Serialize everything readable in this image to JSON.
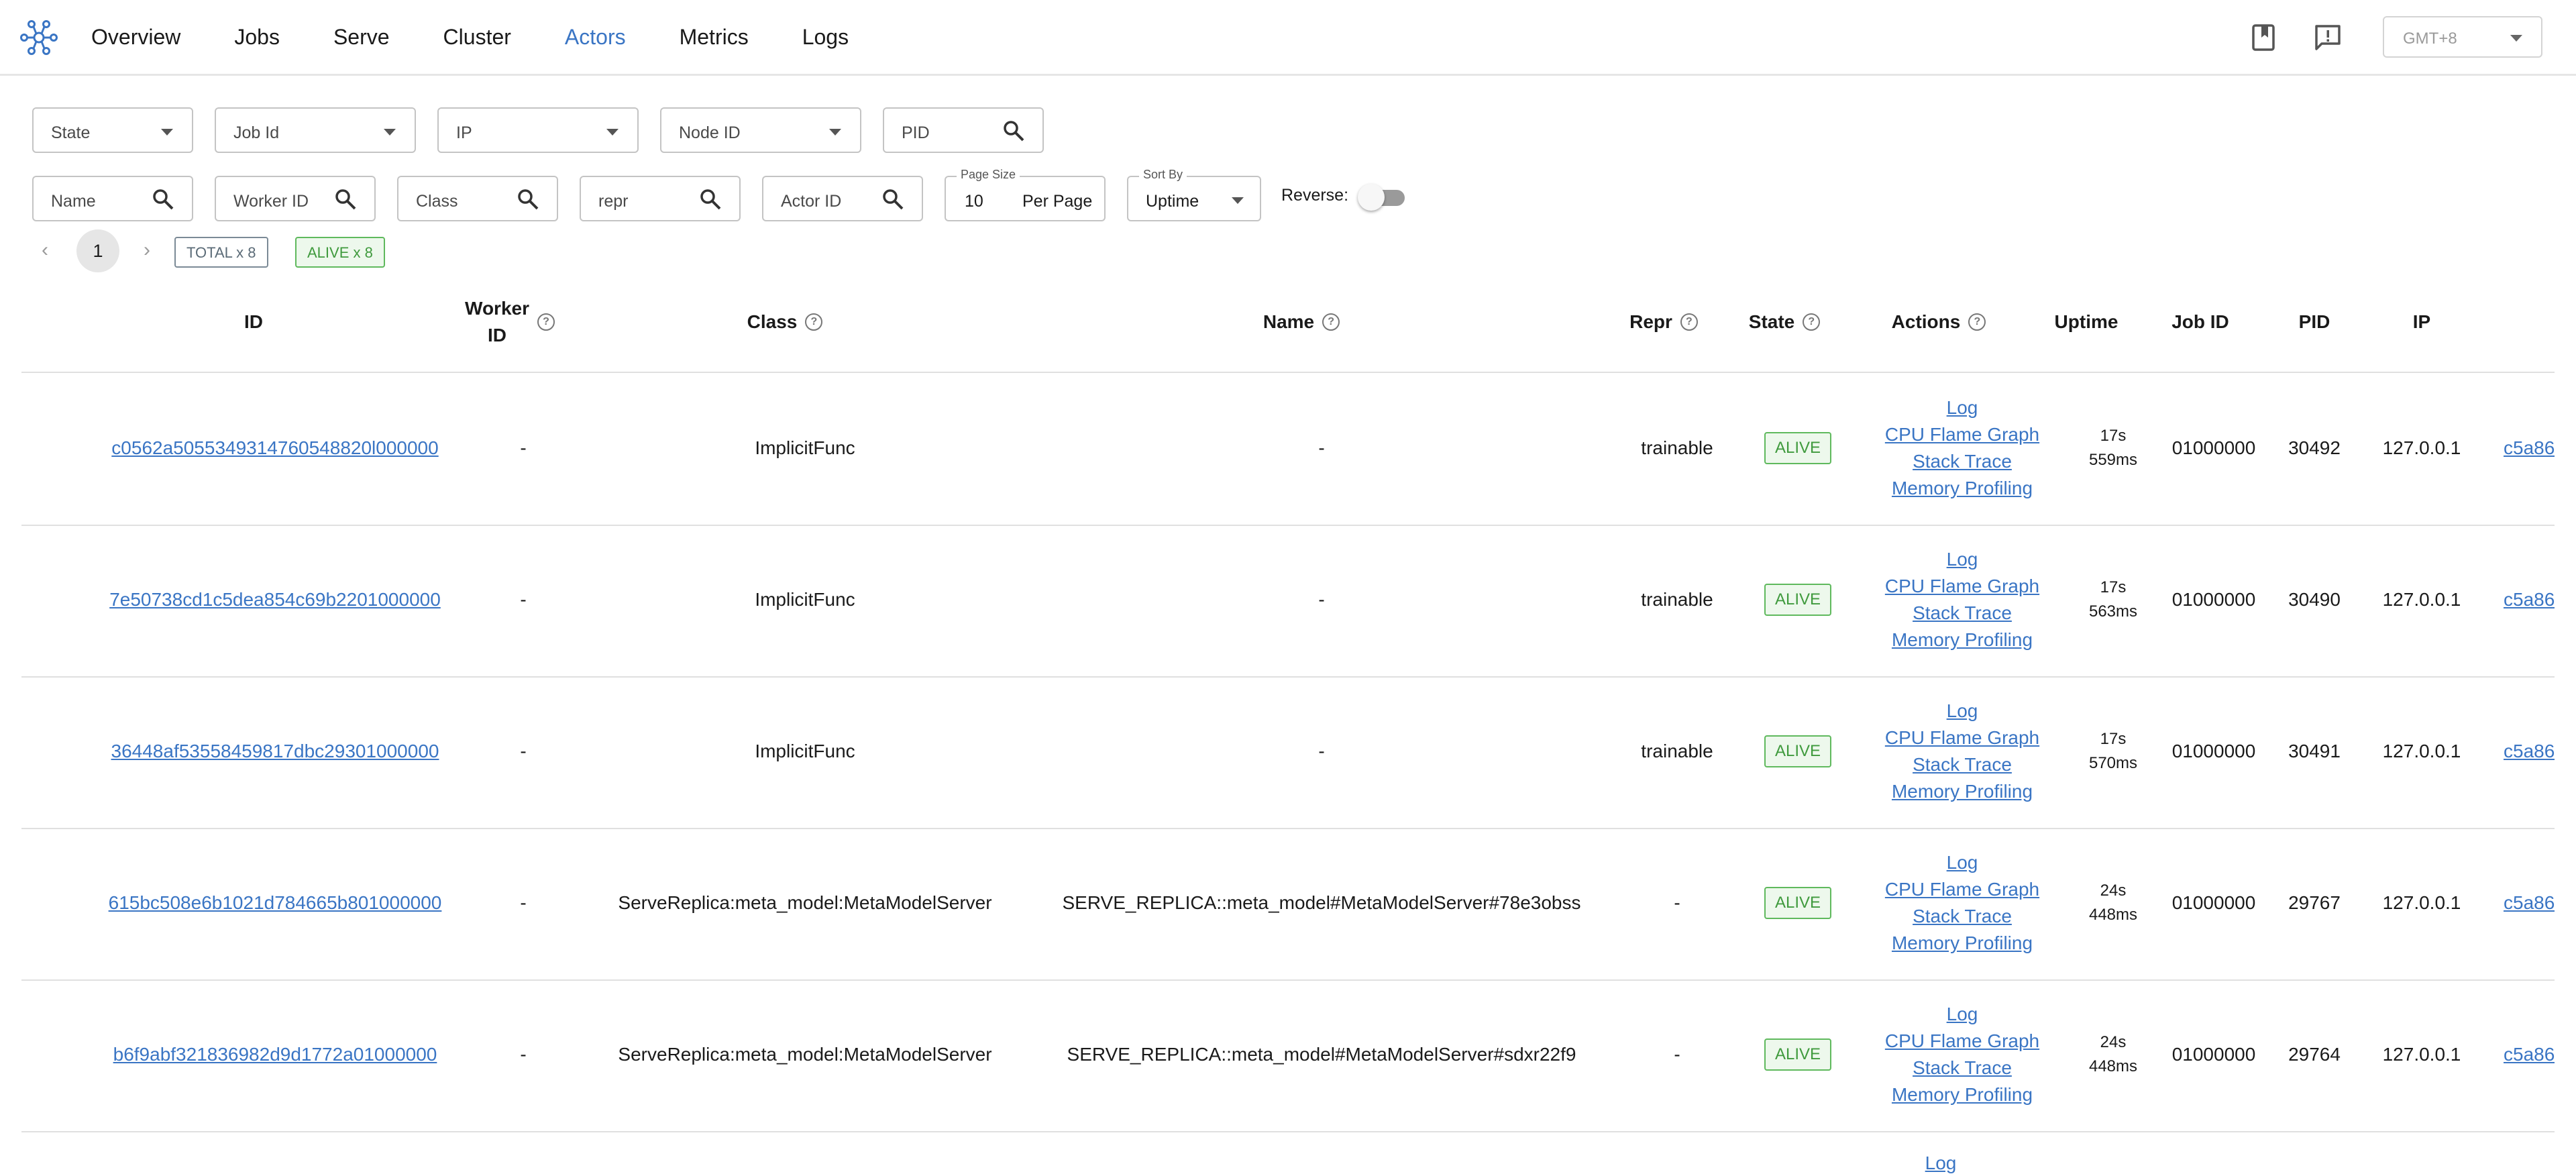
{
  "nav": {
    "links": [
      "Overview",
      "Jobs",
      "Serve",
      "Cluster",
      "Actors",
      "Metrics",
      "Logs"
    ],
    "active": "Actors",
    "timezone": "GMT+8",
    "accent_color": "#3a75c4"
  },
  "filters": {
    "state": "State",
    "job_id": "Job Id",
    "ip": "IP",
    "node_id": "Node ID",
    "pid": "PID",
    "name": "Name",
    "worker_id": "Worker ID",
    "class": "Class",
    "repr": "repr",
    "actor_id": "Actor ID",
    "page_size_label": "Page Size",
    "page_size_value": "10",
    "page_size_suffix": "Per Page",
    "sort_by_label": "Sort By",
    "sort_by_value": "Uptime",
    "reverse_label": "Reverse:",
    "reverse_on": false
  },
  "pagination": {
    "prev": "‹",
    "page": "1",
    "next": "›",
    "total_badge": "TOTAL x 8",
    "alive_badge": "ALIVE x 8"
  },
  "table": {
    "headers": {
      "id": "ID",
      "worker_id_1": "Worker",
      "worker_id_2": "ID",
      "class": "Class",
      "name": "Name",
      "repr": "Repr",
      "state": "State",
      "actions": "Actions",
      "uptime": "Uptime",
      "job_id": "Job ID",
      "pid": "PID",
      "ip": "IP"
    },
    "action_labels": [
      "Log",
      "CPU Flame Graph",
      "Stack Trace",
      "Memory Profiling"
    ],
    "rows": [
      {
        "id": "c0562a5055349314760548820l000000",
        "worker_id": "-",
        "class": "ImplicitFunc",
        "name": "-",
        "repr": "trainable",
        "state": "ALIVE",
        "uptime_1": "17s",
        "uptime_2": "559ms",
        "job_id": "01000000",
        "pid": "30492",
        "ip": "127.0.0.1",
        "node": "c5a86"
      },
      {
        "id": "7e50738cd1c5dea854c69b2201000000",
        "worker_id": "-",
        "class": "ImplicitFunc",
        "name": "-",
        "repr": "trainable",
        "state": "ALIVE",
        "uptime_1": "17s",
        "uptime_2": "563ms",
        "job_id": "01000000",
        "pid": "30490",
        "ip": "127.0.0.1",
        "node": "c5a86"
      },
      {
        "id": "36448af53558459817dbc29301000000",
        "worker_id": "-",
        "class": "ImplicitFunc",
        "name": "-",
        "repr": "trainable",
        "state": "ALIVE",
        "uptime_1": "17s",
        "uptime_2": "570ms",
        "job_id": "01000000",
        "pid": "30491",
        "ip": "127.0.0.1",
        "node": "c5a86"
      },
      {
        "id": "615bc508e6b1021d784665b801000000",
        "worker_id": "-",
        "class": "ServeReplica:meta_model:MetaModelServer",
        "name": "SERVE_REPLICA::meta_model#MetaModelServer#78e3obss",
        "repr": "-",
        "state": "ALIVE",
        "uptime_1": "24s",
        "uptime_2": "448ms",
        "job_id": "01000000",
        "pid": "29767",
        "ip": "127.0.0.1",
        "node": "c5a86"
      },
      {
        "id": "b6f9abf321836982d9d1772a01000000",
        "worker_id": "-",
        "class": "ServeReplica:meta_model:MetaModelServer",
        "name": "SERVE_REPLICA::meta_model#MetaModelServer#sdxr22f9",
        "repr": "-",
        "state": "ALIVE",
        "uptime_1": "24s",
        "uptime_2": "448ms",
        "job_id": "01000000",
        "pid": "29764",
        "ip": "127.0.0.1",
        "node": "c5a86"
      }
    ],
    "partial_row_action": "Log"
  }
}
